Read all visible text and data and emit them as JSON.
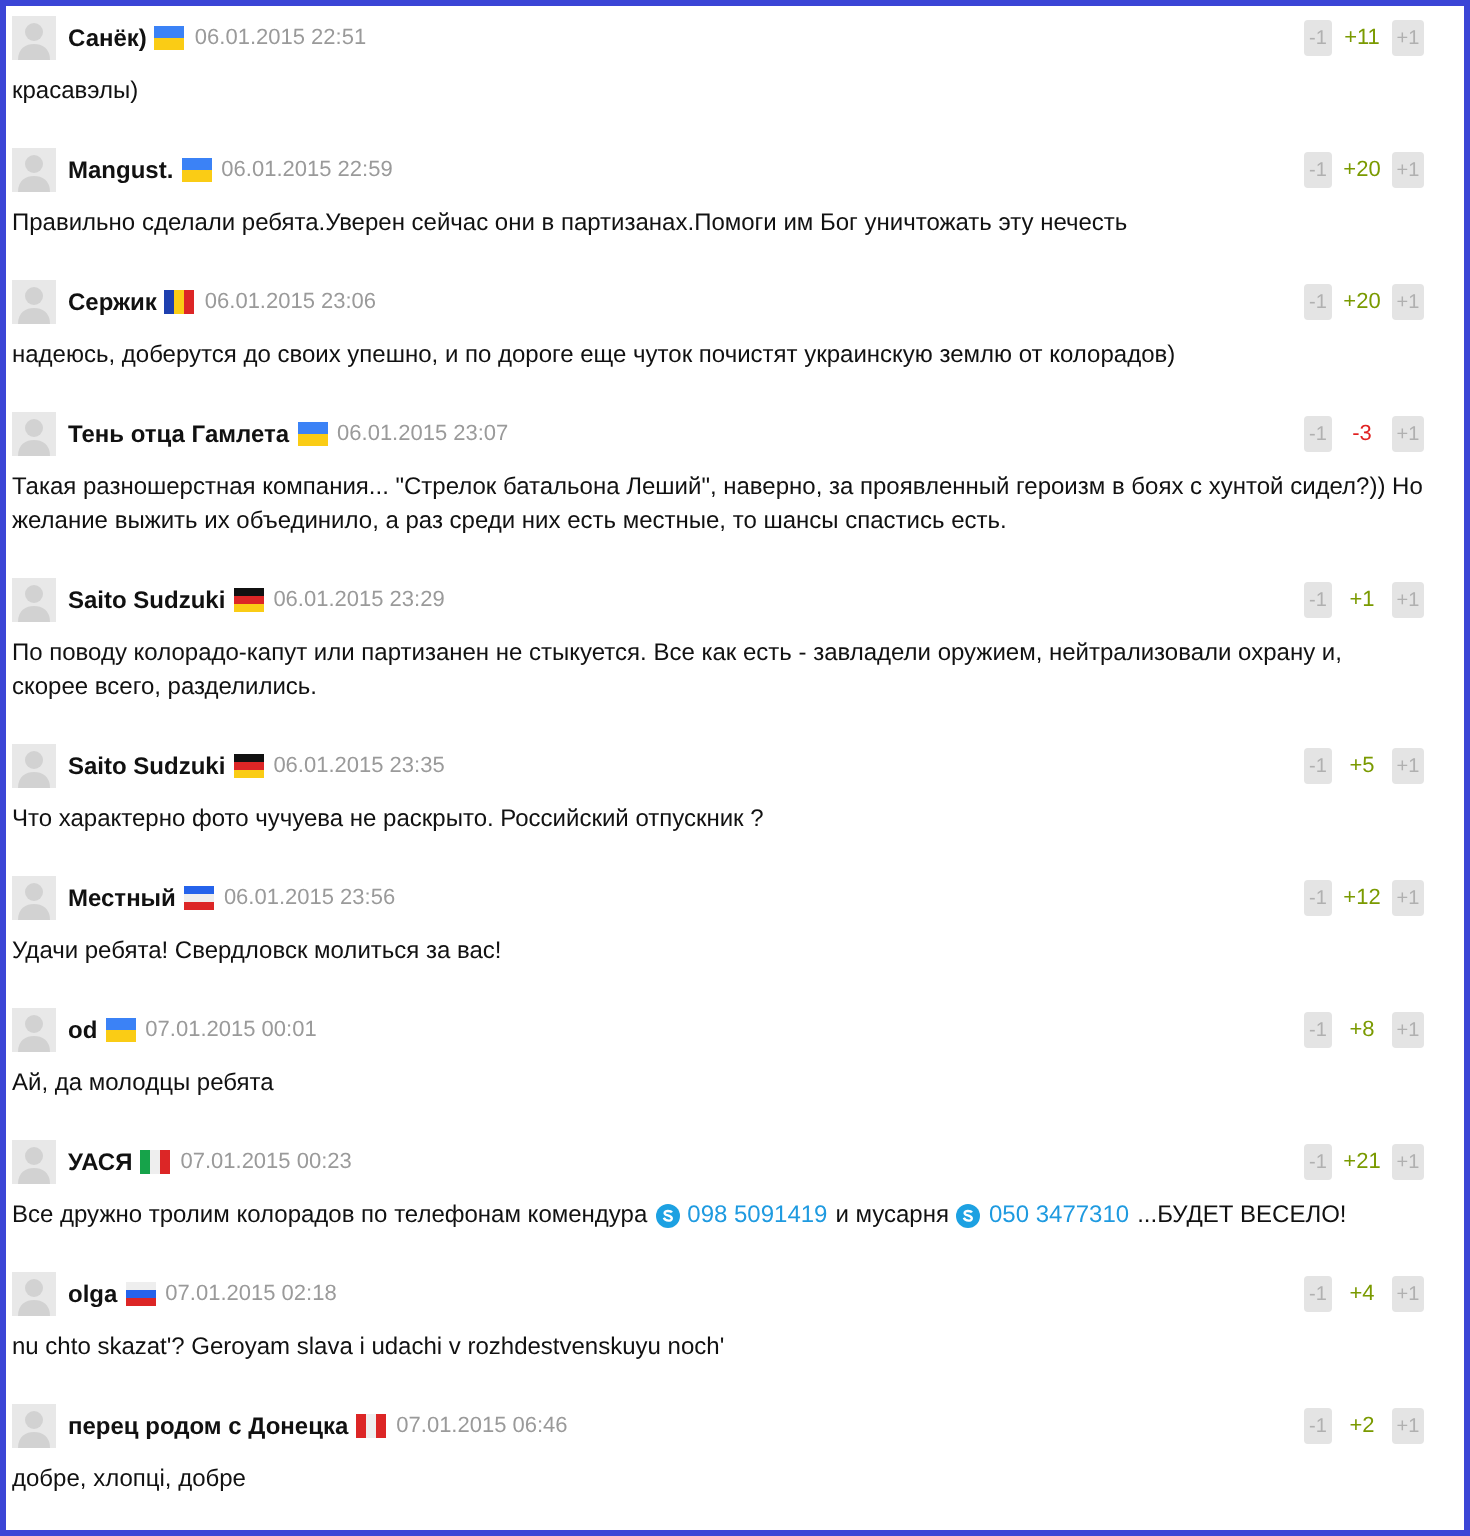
{
  "comments": [
    {
      "author": "Санёк)",
      "flag": {
        "stripes": [
          {
            "color": "#3b82f6"
          },
          {
            "color": "#facc15"
          }
        ],
        "vertical": false
      },
      "date": "06.01.2015 22:51",
      "parts": [
        {
          "kind": "text",
          "text": "красавэлы)"
        }
      ],
      "down": "-1",
      "score": "+11",
      "negative": false,
      "up": "+1"
    },
    {
      "author": "Mangust.",
      "flag": {
        "stripes": [
          {
            "color": "#3b82f6"
          },
          {
            "color": "#facc15"
          }
        ],
        "vertical": false
      },
      "date": "06.01.2015 22:59",
      "parts": [
        {
          "kind": "text",
          "text": "Правильно сделали ребята.Уверен сейчас они в партизанах.Помоги им Бог уничтожать эту нечесть"
        }
      ],
      "down": "-1",
      "score": "+20",
      "negative": false,
      "up": "+1"
    },
    {
      "author": "Сержик",
      "flag": {
        "stripes": [
          {
            "color": "#1e40af"
          },
          {
            "color": "#facc15"
          },
          {
            "color": "#dc2626"
          }
        ],
        "vertical": true
      },
      "date": "06.01.2015 23:06",
      "parts": [
        {
          "kind": "text",
          "text": "надеюсь, доберутся до своих упешно, и по дороге еще чуток почистят украинскую землю от колорадов)"
        }
      ],
      "down": "-1",
      "score": "+20",
      "negative": false,
      "up": "+1"
    },
    {
      "author": "Тень отца Гамлета",
      "flag": {
        "stripes": [
          {
            "color": "#3b82f6"
          },
          {
            "color": "#facc15"
          }
        ],
        "vertical": false
      },
      "date": "06.01.2015 23:07",
      "parts": [
        {
          "kind": "text",
          "text": "Такая разношерстная компания... \"Стрелок батальона Леший\", наверно, за проявленный героизм в боях с хунтой сидел?)) Но желание выжить их объединило, а раз среди них есть местные, то шансы спастись есть."
        }
      ],
      "down": "-1",
      "score": "-3",
      "negative": true,
      "up": "+1"
    },
    {
      "author": "Saito Sudzuki",
      "flag": {
        "stripes": [
          {
            "color": "#111111"
          },
          {
            "color": "#dc2626"
          },
          {
            "color": "#facc15"
          }
        ],
        "vertical": false
      },
      "date": "06.01.2015 23:29",
      "parts": [
        {
          "kind": "text",
          "text": "По поводу колорадо-капут или партизанен не стыкуется. Все как есть - завладели оружием, нейтрализовали охрану и, скорее всего, разделились."
        }
      ],
      "down": "-1",
      "score": "+1",
      "negative": false,
      "up": "+1"
    },
    {
      "author": "Saito Sudzuki",
      "flag": {
        "stripes": [
          {
            "color": "#111111"
          },
          {
            "color": "#dc2626"
          },
          {
            "color": "#facc15"
          }
        ],
        "vertical": false
      },
      "date": "06.01.2015 23:35",
      "parts": [
        {
          "kind": "text",
          "text": "Что характерно фото чучуева не раскрыто. Российский отпускник ?"
        }
      ],
      "down": "-1",
      "score": "+5",
      "negative": false,
      "up": "+1"
    },
    {
      "author": "Местный",
      "flag": {
        "stripes": [
          {
            "color": "#2563eb"
          },
          {
            "color": "#eeeeee"
          },
          {
            "color": "#dc2626"
          }
        ],
        "vertical": false
      },
      "date": "06.01.2015 23:56",
      "parts": [
        {
          "kind": "text",
          "text": "Удачи ребята! Свердловск молиться за вас!"
        }
      ],
      "down": "-1",
      "score": "+12",
      "negative": false,
      "up": "+1"
    },
    {
      "author": "od",
      "flag": {
        "stripes": [
          {
            "color": "#3b82f6"
          },
          {
            "color": "#facc15"
          }
        ],
        "vertical": false
      },
      "date": "07.01.2015 00:01",
      "parts": [
        {
          "kind": "text",
          "text": "Ай, да молодцы ребята"
        }
      ],
      "down": "-1",
      "score": "+8",
      "negative": false,
      "up": "+1"
    },
    {
      "author": "УАСЯ",
      "flag": {
        "stripes": [
          {
            "color": "#16a34a"
          },
          {
            "color": "#eeeeee"
          },
          {
            "color": "#dc2626"
          }
        ],
        "vertical": true
      },
      "date": "07.01.2015 00:23",
      "parts": [
        {
          "kind": "text",
          "text": "Все дружно тролим колорадов по телефонам комендура"
        },
        {
          "kind": "phone",
          "text": "098 5091419"
        },
        {
          "kind": "text",
          "text": "и мусарня"
        },
        {
          "kind": "phone",
          "text": "050 3477310"
        },
        {
          "kind": "text",
          "text": "...БУДЕТ ВЕСЕЛО!"
        }
      ],
      "down": "-1",
      "score": "+21",
      "negative": false,
      "up": "+1"
    },
    {
      "author": "olga",
      "flag": {
        "stripes": [
          {
            "color": "#eeeeee"
          },
          {
            "color": "#2563eb"
          },
          {
            "color": "#dc2626"
          }
        ],
        "vertical": false
      },
      "date": "07.01.2015 02:18",
      "parts": [
        {
          "kind": "text",
          "text": "nu chto skazat'? Geroyam slava i udachi v rozhdestvenskuyu noch'"
        }
      ],
      "down": "-1",
      "score": "+4",
      "negative": false,
      "up": "+1"
    },
    {
      "author": "перец родом с Донецка",
      "flag": {
        "stripes": [
          {
            "color": "#dc2626"
          },
          {
            "color": "#eeeeee"
          },
          {
            "color": "#dc2626"
          }
        ],
        "vertical": true
      },
      "date": "07.01.2015 06:46",
      "parts": [
        {
          "kind": "text",
          "text": "добре, хлопці, добре"
        }
      ],
      "down": "-1",
      "score": "+2",
      "negative": false,
      "up": "+1"
    }
  ]
}
